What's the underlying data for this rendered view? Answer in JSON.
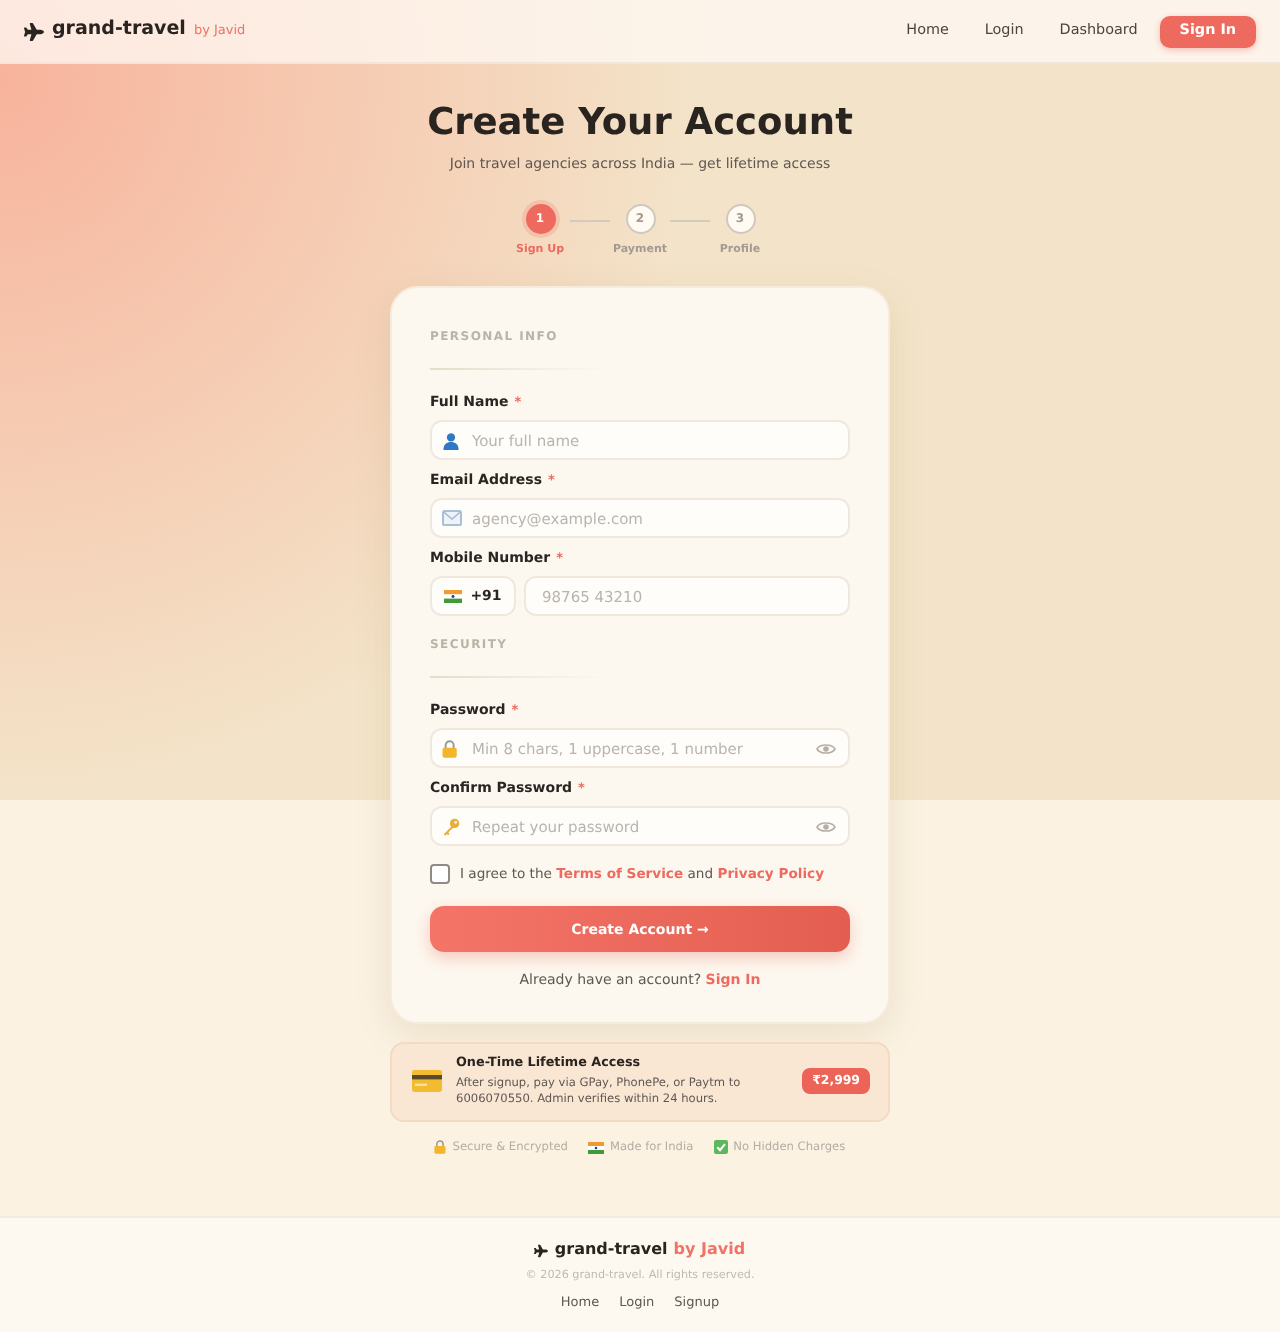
{
  "header": {
    "brand": "grand-travel",
    "byline": "by Javid",
    "nav": [
      {
        "label": "Home"
      },
      {
        "label": "Login"
      },
      {
        "label": "Dashboard"
      }
    ],
    "cta": "Sign In"
  },
  "hero": {
    "title": "Create Your Account",
    "subtitle": "Join travel agencies across India — get lifetime access"
  },
  "steps": [
    {
      "number": "1",
      "label": "Sign Up",
      "selected": true
    },
    {
      "number": "2",
      "label": "Payment",
      "selected": false
    },
    {
      "number": "3",
      "label": "Profile",
      "selected": false
    }
  ],
  "form": {
    "sections": [
      {
        "heading": "PERSONAL INFO",
        "fields": [
          {
            "kind": "text",
            "label": "Full Name",
            "required_mark": "*",
            "placeholder": "Your full name"
          },
          {
            "kind": "email",
            "label": "Email Address",
            "required_mark": "*",
            "placeholder": "agency@example.com"
          },
          {
            "kind": "phone",
            "label": "Mobile Number",
            "required_mark": "*",
            "country_code": "+91",
            "placeholder": "98765 43210"
          }
        ]
      },
      {
        "heading": "SECURITY",
        "fields": [
          {
            "kind": "password",
            "label": "Password",
            "required_mark": "*",
            "placeholder": "Min 8 chars, 1 uppercase, 1 number"
          },
          {
            "kind": "password_confirm",
            "label": "Confirm Password",
            "required_mark": "*",
            "placeholder": "Repeat your password"
          }
        ]
      }
    ],
    "agreement": {
      "checked": false,
      "prefix": "I agree to the",
      "terms_link": "Terms of Service",
      "joiner": "and",
      "privacy_link": "Privacy Policy"
    },
    "submit": "Create Account →",
    "signin_prompt": {
      "text": "Already have an account?",
      "link": "Sign In"
    }
  },
  "plan": {
    "title": "One-Time Lifetime Access",
    "description": "After signup, pay via GPay, PhonePe, or Paytm to 6006070550. Admin verifies within 24 hours.",
    "price": "₹2,999"
  },
  "trust": [
    {
      "kind": "secure",
      "label": "Secure & Encrypted"
    },
    {
      "kind": "india",
      "label": "Made for India"
    },
    {
      "kind": "no_charges",
      "label": "No Hidden Charges"
    }
  ],
  "footer": {
    "brand": "grand-travel",
    "byline": "by Javid",
    "copyright": "© 2026 grand-travel. All rights reserved.",
    "links": [
      {
        "label": "Home"
      },
      {
        "label": "Login"
      },
      {
        "label": "Signup"
      }
    ]
  }
}
